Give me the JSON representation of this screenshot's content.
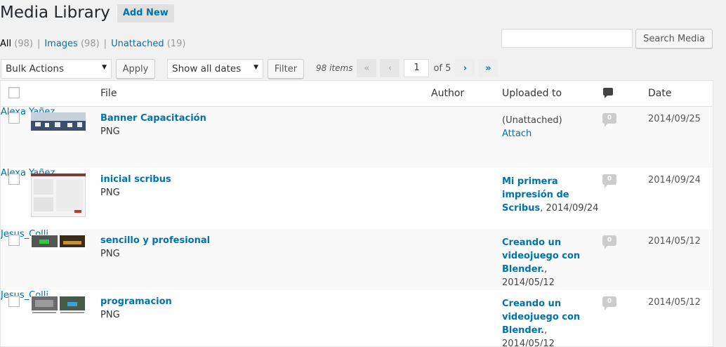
{
  "header": {
    "title": "Media Library",
    "add_new": "Add New"
  },
  "views": [
    {
      "label": "All",
      "count": "(98)"
    },
    {
      "label": "Images",
      "count": "(98)"
    },
    {
      "label": "Unattached",
      "count": "(19)"
    }
  ],
  "views_sep": "|",
  "search": {
    "value": "",
    "button": "Search Media"
  },
  "tablenav": {
    "bulk_actions": "Bulk Actions",
    "apply": "Apply",
    "date_filter": "Show all dates",
    "filter": "Filter",
    "items": "98 items",
    "first": "«",
    "prev": "‹",
    "current_page": "1",
    "of_pages": "of 5",
    "next": "›",
    "last": "»"
  },
  "columns": {
    "file": "File",
    "author": "Author",
    "uploaded_to": "Uploaded to",
    "date": "Date"
  },
  "rows": [
    {
      "title": "Banner Capacitación",
      "ext": "PNG",
      "author": "Alexa Yañez",
      "uploaded_line1": "(Unattached)",
      "uploaded_link": "Attach",
      "comments": "0",
      "date": "2014/09/25"
    },
    {
      "title": "inicial scribus",
      "ext": "PNG",
      "author": "Alexa Yañez",
      "uploaded_post_1": "Mi primera",
      "uploaded_post_2": "impresión de",
      "uploaded_post_3": "Scribus",
      "uploaded_date": ", 2014/09/24",
      "comments": "0",
      "date": "2014/09/24"
    },
    {
      "title": "sencillo y profesional",
      "ext": "PNG",
      "author": "Jesus_Colli",
      "uploaded_post_1": "Creando un",
      "uploaded_post_2": "videojuego con",
      "uploaded_post_3": "Blender.",
      "uploaded_date": ", 2014/05/12",
      "comments": "0",
      "date": "2014/05/12"
    },
    {
      "title": "programacion",
      "ext": "PNG",
      "author": "Jesus_Colli",
      "uploaded_post_1": "Creando un",
      "uploaded_post_2": "videojuego con",
      "uploaded_post_3": "Blender.",
      "uploaded_date": ", 2014/05/12",
      "comments": "0",
      "date": "2014/05/12"
    }
  ],
  "icons": {
    "comments_header": "comment-bubble-icon",
    "select_arrow": "triangle-down-icon"
  },
  "colors": {
    "link": "#0073aa",
    "background": "#f1f1f1",
    "bubble": "#cccccc"
  }
}
